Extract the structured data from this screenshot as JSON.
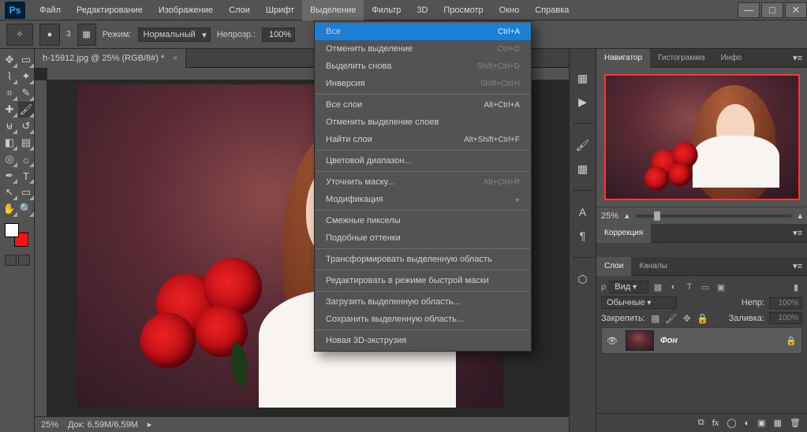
{
  "app": {
    "logo": "Ps"
  },
  "menus": [
    "Файл",
    "Редактирование",
    "Изображение",
    "Слои",
    "Шрифт",
    "Выделение",
    "Фильтр",
    "3D",
    "Просмотр",
    "Окно",
    "Справка"
  ],
  "activeMenuIndex": 5,
  "options": {
    "brushSize": "3",
    "modeLabel": "Режим:",
    "modeValue": "Нормальный",
    "opacityLabel": "Непрозр.:",
    "opacityValue": "100%"
  },
  "docTab": {
    "title": "h-15912.jpg @ 25% (RGB/8#) *"
  },
  "docStatus": {
    "zoom": "25%",
    "size": "Док: 6,59M/6,59M"
  },
  "dropdown": {
    "groups": [
      [
        {
          "label": "Все",
          "shortcut": "Ctrl+A",
          "highlight": true
        },
        {
          "label": "Отменить выделение",
          "shortcut": "Ctrl+D",
          "disabled": true
        },
        {
          "label": "Выделить снова",
          "shortcut": "Shift+Ctrl+D",
          "disabled": true
        },
        {
          "label": "Инверсия",
          "shortcut": "Shift+Ctrl+I",
          "disabled": true
        }
      ],
      [
        {
          "label": "Все слои",
          "shortcut": "Alt+Ctrl+A"
        },
        {
          "label": "Отменить выделение слоев",
          "shortcut": ""
        },
        {
          "label": "Найти слои",
          "shortcut": "Alt+Shift+Ctrl+F"
        }
      ],
      [
        {
          "label": "Цветовой диапазон...",
          "shortcut": ""
        }
      ],
      [
        {
          "label": "Уточнить маску...",
          "shortcut": "Alt+Ctrl+R",
          "disabled": true
        },
        {
          "label": "Модификация",
          "shortcut": "",
          "submenu": true,
          "disabled": true
        }
      ],
      [
        {
          "label": "Смежные пикселы",
          "shortcut": "",
          "disabled": true
        },
        {
          "label": "Подобные оттенки",
          "shortcut": "",
          "disabled": true
        }
      ],
      [
        {
          "label": "Трансформировать выделенную область",
          "shortcut": "",
          "disabled": true
        }
      ],
      [
        {
          "label": "Редактировать в режиме быстрой маски",
          "shortcut": ""
        }
      ],
      [
        {
          "label": "Загрузить выделенную область...",
          "shortcut": "",
          "disabled": true
        },
        {
          "label": "Сохранить выделенную область...",
          "shortcut": "",
          "disabled": true
        }
      ],
      [
        {
          "label": "Новая 3D-экструзия",
          "shortcut": "",
          "disabled": true
        }
      ]
    ]
  },
  "panels": {
    "navTabs": [
      "Навигатор",
      "Гистограмма",
      "Инфо"
    ],
    "navActive": 0,
    "navZoom": "25%",
    "correctionTab": "Коррекция",
    "layersTabs": [
      "Слои",
      "Каналы"
    ],
    "layersActive": 0,
    "kindLabel": "Вид",
    "blendValue": "Обычные",
    "opacityLabel": "Непр:",
    "opacityValue": "100%",
    "lockLabel": "Закрепить:",
    "fillLabel": "Заливка:",
    "fillValue": "100%",
    "layerName": "Фон"
  }
}
